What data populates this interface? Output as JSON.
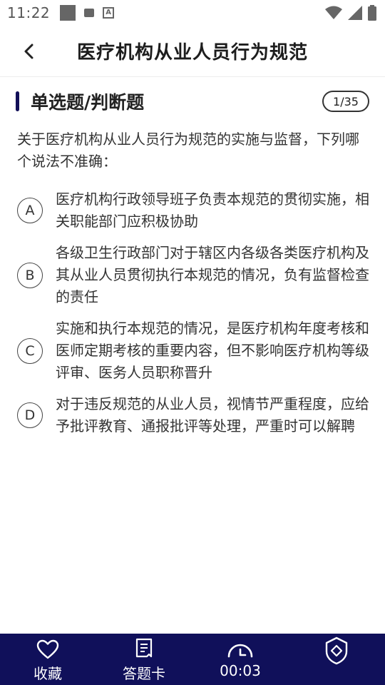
{
  "status_bar": {
    "time": "11:22"
  },
  "header": {
    "title": "医疗机构从业人员行为规范"
  },
  "section": {
    "title": "单选题/判断题",
    "progress": "1/35"
  },
  "question": {
    "text": "关于医疗机构从业人员行为规范的实施与监督，下列哪个说法不准确："
  },
  "options": [
    {
      "letter": "A",
      "text": "医疗机构行政领导班子负责本规范的贯彻实施，相关职能部门应积极协助"
    },
    {
      "letter": "B",
      "text": "各级卫生行政部门对于辖区内各级各类医疗机构及其从业人员贯彻执行本规范的情况，负有监督检查的责任"
    },
    {
      "letter": "C",
      "text": "实施和执行本规范的情况，是医疗机构年度考核和医师定期考核的重要内容，但不影响医疗机构等级评审、医务人员职称晋升"
    },
    {
      "letter": "D",
      "text": "对于违反规范的从业人员，视情节严重程度，应给予批评教育、通报批评等处理，严重时可以解聘"
    }
  ],
  "bottom_nav": {
    "favorite_label": "收藏",
    "answer_card_label": "答题卡",
    "timer": "00:03"
  },
  "colors": {
    "nav_bg": "#10105a",
    "accent_bar": "#121058"
  }
}
